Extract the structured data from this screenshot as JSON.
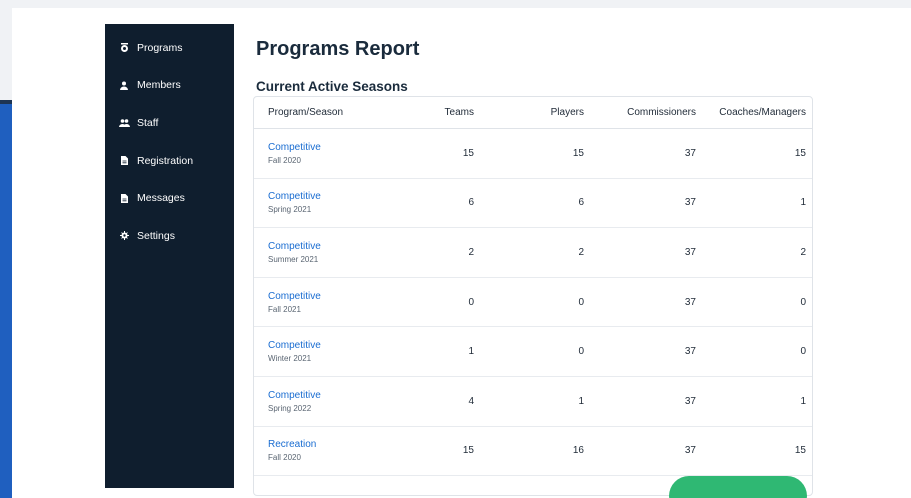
{
  "sidebar": {
    "items": [
      {
        "label": "Programs",
        "icon": "programs-icon"
      },
      {
        "label": "Members",
        "icon": "user-icon"
      },
      {
        "label": "Staff",
        "icon": "users-icon"
      },
      {
        "label": "Registration",
        "icon": "file-icon"
      },
      {
        "label": "Messages",
        "icon": "file-icon"
      },
      {
        "label": "Settings",
        "icon": "gear-icon"
      }
    ]
  },
  "main": {
    "title": "Programs Report",
    "section_title": "Current Active Seasons",
    "table": {
      "headers": [
        "Program/Season",
        "Teams",
        "Players",
        "Commissioners",
        "Coaches/Managers"
      ],
      "rows": [
        {
          "program": "Competitive",
          "season": "Fall 2020",
          "teams": "15",
          "players": "15",
          "commissioners": "37",
          "coaches": "15"
        },
        {
          "program": "Competitive",
          "season": "Spring 2021",
          "teams": "6",
          "players": "6",
          "commissioners": "37",
          "coaches": "1"
        },
        {
          "program": "Competitive",
          "season": "Summer 2021",
          "teams": "2",
          "players": "2",
          "commissioners": "37",
          "coaches": "2"
        },
        {
          "program": "Competitive",
          "season": "Fall 2021",
          "teams": "0",
          "players": "0",
          "commissioners": "37",
          "coaches": "0"
        },
        {
          "program": "Competitive",
          "season": "Winter 2021",
          "teams": "1",
          "players": "0",
          "commissioners": "37",
          "coaches": "0"
        },
        {
          "program": "Competitive",
          "season": "Spring 2022",
          "teams": "4",
          "players": "1",
          "commissioners": "37",
          "coaches": "1"
        },
        {
          "program": "Recreation",
          "season": "Fall 2020",
          "teams": "15",
          "players": "16",
          "commissioners": "37",
          "coaches": "15"
        }
      ]
    }
  },
  "colors": {
    "sidebar_bg": "#0f1e2e",
    "link": "#1a6dd1",
    "fab": "#2fb873"
  }
}
